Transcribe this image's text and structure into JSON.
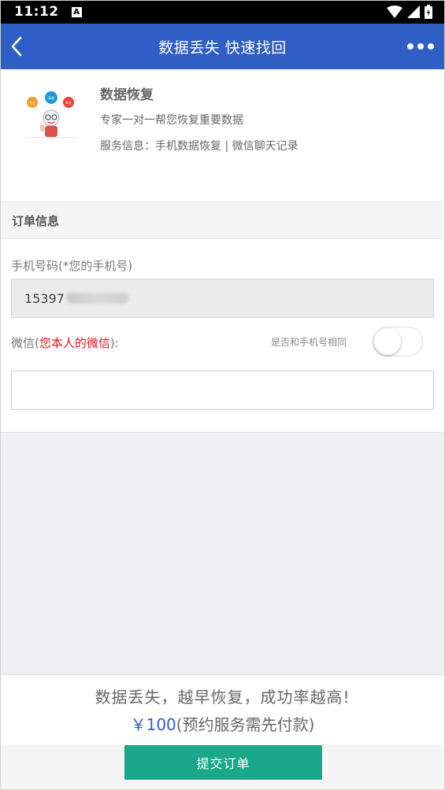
{
  "status_bar": {
    "time": "11:12",
    "notification_icon": "A"
  },
  "nav": {
    "title": "数据丢失 快速找回",
    "back_icon": "chevron-left",
    "more_icon": "ellipsis"
  },
  "product": {
    "title": "数据恢复",
    "description": "专家一对一帮您恢复重要数据",
    "service_info": "服务信息：手机数据恢复 | 微信聊天记录",
    "image_bubbles": [
      "专业",
      "高效",
      "安全"
    ]
  },
  "order_section": {
    "header": "订单信息"
  },
  "form": {
    "phone_label": "手机号码(*您的手机号)",
    "phone_value": "15397",
    "wechat_label_prefix": "微信(",
    "wechat_label_highlight": "您本人的微信",
    "wechat_label_suffix": "):",
    "same_as_phone_label": "是否和手机号相同",
    "same_as_phone_toggle": false,
    "wechat_value": "",
    "wechat_placeholder": ""
  },
  "footer": {
    "slogan": "数据丢失，越早恢复，成功率越高!",
    "price": "￥100",
    "price_note": "(预约服务需先付款)",
    "submit_label": "提交订单"
  },
  "colors": {
    "nav_bg": "#2f5ec4",
    "submit_bg": "#1aa988",
    "highlight_red": "#e5141d",
    "price_blue": "#2f5ec4"
  }
}
